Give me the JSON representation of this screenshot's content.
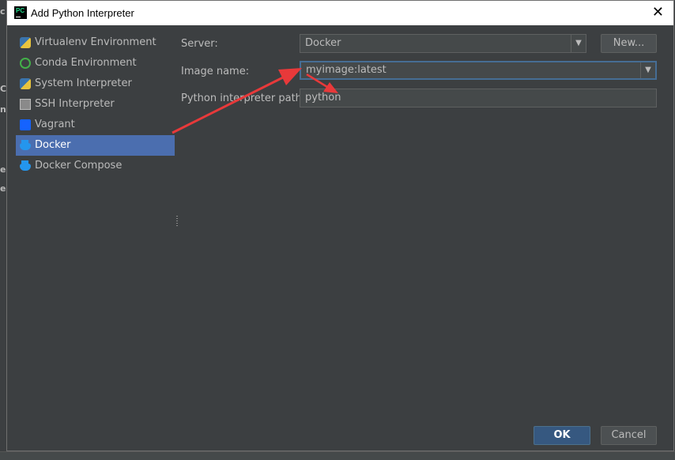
{
  "dialog": {
    "title": "Add Python Interpreter",
    "app_icon_text": "PC",
    "close_glyph": "✕"
  },
  "sidebar": {
    "items": [
      {
        "label": "Virtualenv Environment",
        "icon": "virtualenv-icon"
      },
      {
        "label": "Conda Environment",
        "icon": "conda-icon"
      },
      {
        "label": "System Interpreter",
        "icon": "python-icon"
      },
      {
        "label": "SSH Interpreter",
        "icon": "ssh-icon"
      },
      {
        "label": "Vagrant",
        "icon": "vagrant-icon"
      },
      {
        "label": "Docker",
        "icon": "docker-icon",
        "selected": true
      },
      {
        "label": "Docker Compose",
        "icon": "docker-compose-icon"
      }
    ]
  },
  "form": {
    "server_label": "Server:",
    "server_value": "Docker",
    "new_button": "New...",
    "image_label": "Image name:",
    "image_value": "myimage:latest",
    "path_label": "Python interpreter path:",
    "path_value": "python"
  },
  "buttons": {
    "ok": "OK",
    "cancel": "Cancel"
  },
  "colors": {
    "background": "#3c3f41",
    "selection": "#4b6eaf",
    "focus_border": "#466d94",
    "annotation_arrow": "#e8393a"
  }
}
